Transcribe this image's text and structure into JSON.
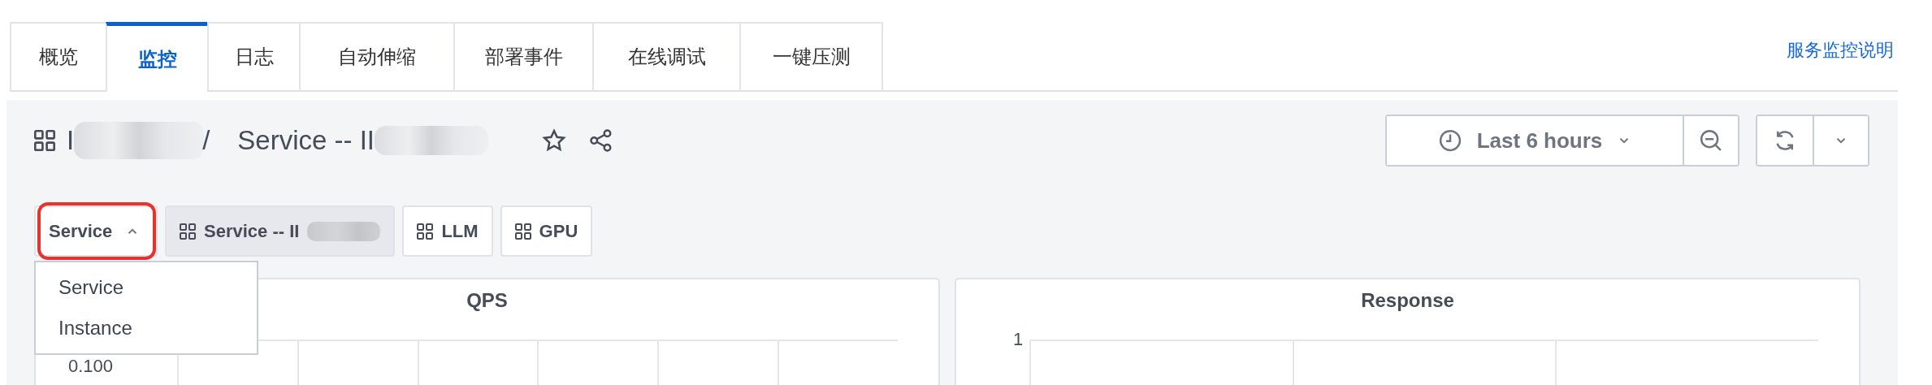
{
  "tabs": [
    {
      "label": "概览",
      "selected": false
    },
    {
      "label": "监控",
      "selected": true
    },
    {
      "label": "日志",
      "selected": false
    },
    {
      "label": "自动伸缩",
      "selected": false
    },
    {
      "label": "部署事件",
      "selected": false
    },
    {
      "label": "在线调试",
      "selected": false
    },
    {
      "label": "一键压测",
      "selected": false
    }
  ],
  "help_link": "服务监控说明",
  "dashboard": {
    "breadcrumb": [
      {
        "text": "I",
        "redacted": true
      },
      {
        "text": "Service -- II",
        "redacted": true
      }
    ],
    "separator": "/",
    "starred": false,
    "time_range": {
      "label": "Last 6 hours"
    },
    "variables": [
      {
        "kind": "dropdown",
        "label": "Service",
        "expanded": true,
        "highlighted": true,
        "options": [
          {
            "label": "Service"
          },
          {
            "label": "Instance"
          }
        ]
      },
      {
        "kind": "link",
        "label": "Service -- II",
        "selected": true,
        "redacted": true
      },
      {
        "kind": "link",
        "label": "LLM",
        "selected": false,
        "redacted": false
      },
      {
        "kind": "link",
        "label": "GPU",
        "selected": false,
        "redacted": false
      }
    ],
    "panels": [
      {
        "title": "QPS",
        "y_tick": "0.100"
      },
      {
        "title": "Response",
        "y_tick": "1"
      }
    ]
  }
}
